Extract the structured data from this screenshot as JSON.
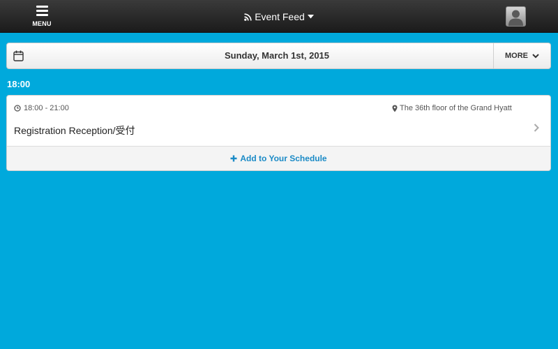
{
  "header": {
    "menu_label": "MENU",
    "feed_title": "Event Feed"
  },
  "datebar": {
    "date": "Sunday, March 1st, 2015",
    "more_label": "MORE"
  },
  "schedule": {
    "time_header": "18:00",
    "event": {
      "time_range": "18:00 - 21:00",
      "location": "The 36th floor of the Grand Hyatt",
      "title": "Registration Reception/受付",
      "add_label": "Add to Your Schedule"
    }
  },
  "colors": {
    "background": "#00a9dc",
    "topbar": "#2a2a2a",
    "link": "#1a8ac6"
  },
  "icons": {
    "menu": "hamburger-icon",
    "feed": "rss-icon",
    "dropdown": "caret-down-icon",
    "profile": "user-avatar-icon",
    "calendar": "calendar-icon",
    "more": "chevron-down-icon",
    "clock": "clock-icon",
    "location": "map-pin-icon",
    "open": "chevron-right-icon",
    "add": "plus-icon"
  }
}
